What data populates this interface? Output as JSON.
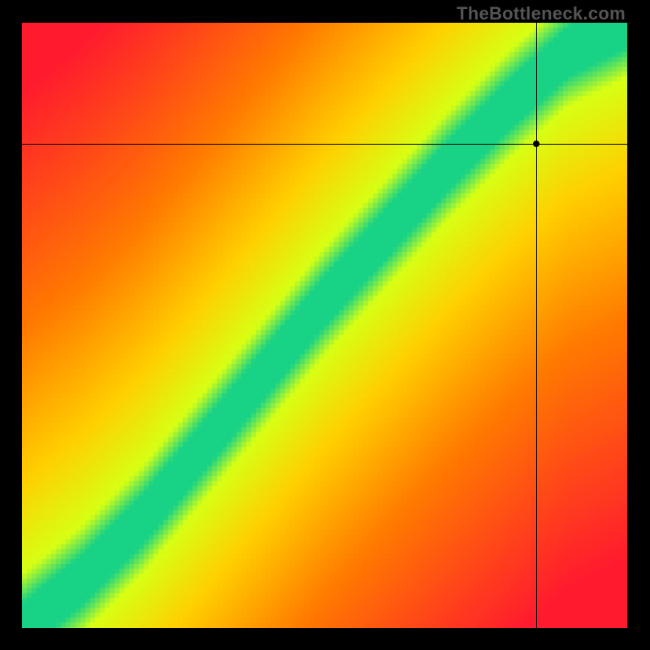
{
  "watermark": "TheBottleneck.com",
  "chart_data": {
    "type": "heatmap",
    "title": "",
    "xlabel": "",
    "ylabel": "",
    "xlim": [
      0,
      100
    ],
    "ylim": [
      0,
      100
    ],
    "crosshair": {
      "x": 85,
      "y": 80
    },
    "green_band": {
      "description": "diagonal band of optimal pairing, curved slightly; width ~6-10 units around the center curve",
      "center_curve_points": [
        {
          "x": 0,
          "y": 0
        },
        {
          "x": 10,
          "y": 8
        },
        {
          "x": 20,
          "y": 18
        },
        {
          "x": 30,
          "y": 30
        },
        {
          "x": 40,
          "y": 42
        },
        {
          "x": 50,
          "y": 54
        },
        {
          "x": 60,
          "y": 65
        },
        {
          "x": 70,
          "y": 76
        },
        {
          "x": 80,
          "y": 86
        },
        {
          "x": 90,
          "y": 95
        },
        {
          "x": 100,
          "y": 100
        }
      ],
      "half_width": 4
    },
    "legend_colors": {
      "best": "#18d286",
      "good": "#d7ff14",
      "mid": "#ffd000",
      "warn": "#ff7a00",
      "bad": "#ff1a2e"
    }
  }
}
